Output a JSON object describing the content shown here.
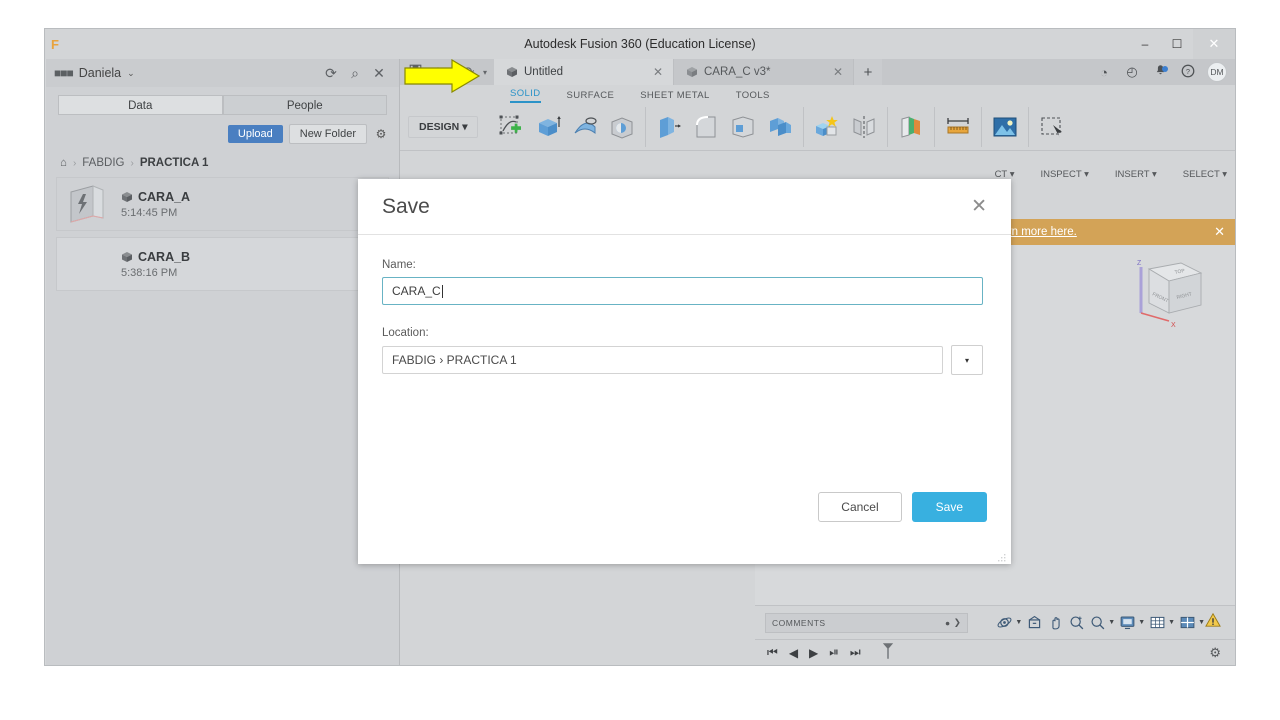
{
  "window": {
    "title": "Autodesk Fusion 360 (Education License)",
    "logo": "F",
    "minimize": "–",
    "maximize": "☐",
    "close": "✕"
  },
  "data_panel": {
    "user_name": "Daniela",
    "user_caret": "⌄",
    "people_icon": "people-icon",
    "refresh_icon": "⟳",
    "search_icon": "⌕",
    "close_icon": "✕",
    "tabs": [
      {
        "label": "Data",
        "active": true
      },
      {
        "label": "People",
        "active": false
      }
    ],
    "upload_label": "Upload",
    "new_folder_label": "New Folder",
    "gear_icon": "⚙",
    "breadcrumb": {
      "home_icon": "⌂",
      "items": [
        "FABDIG",
        "PRACTICA 1"
      ],
      "separator": "›"
    },
    "files": [
      {
        "name": "CARA_A",
        "time": "5:14:45 PM",
        "selected": true
      },
      {
        "name": "CARA_B",
        "time": "5:38:16 PM",
        "selected": false
      }
    ]
  },
  "quick_access": {
    "save_icon": "save-icon",
    "undo_icon": "↶",
    "redo_icon": "↷",
    "dropdown_caret": "▾"
  },
  "doc_tabs": [
    {
      "label": "Untitled",
      "active": true,
      "close": "✕"
    },
    {
      "label": "CARA_C v3*",
      "active": false,
      "close": "✕"
    }
  ],
  "tab_plus": "+",
  "top_right_icons": [
    {
      "name": "job-status-icon",
      "glyph": "◔"
    },
    {
      "name": "recent-activity-icon",
      "glyph": "◴"
    },
    {
      "name": "notifications-bell-icon",
      "glyph": "🔔"
    },
    {
      "name": "help-icon",
      "glyph": "?"
    }
  ],
  "avatar_initials": "DM",
  "ribbon": {
    "tabs": [
      {
        "label": "SOLID",
        "active": true
      },
      {
        "label": "SURFACE",
        "active": false
      },
      {
        "label": "SHEET METAL",
        "active": false
      },
      {
        "label": "TOOLS",
        "active": false
      }
    ],
    "design_label": "DESIGN",
    "design_caret": "▾",
    "group_labels": [
      "CT ▾",
      "INSPECT ▾",
      "INSERT ▾",
      "SELECT ▾"
    ],
    "tools": [
      "create-sketch-icon",
      "extrude-icon",
      "revolve-icon",
      "hole-icon",
      "shell-icon",
      "fillet-icon",
      "draft-icon",
      "combine-icon",
      "appearance-icon",
      "mirror-icon",
      "plane-icon",
      "measure-icon",
      "insert-image-icon",
      "select-icon"
    ]
  },
  "banner": {
    "text": "earn more here.",
    "close": "✕"
  },
  "viewcube": {
    "axis_z": "Z",
    "axis_x": "X",
    "face_top": "TOP",
    "face_front": "FRONT",
    "face_right": "RIGHT"
  },
  "bottom": {
    "comments_label": "COMMENTS",
    "comments_badge": "●",
    "comments_expand": "❯",
    "nav_tools": [
      {
        "name": "orbit-icon",
        "caret": "▾"
      },
      {
        "name": "look-at-icon",
        "caret": ""
      },
      {
        "name": "pan-icon",
        "caret": ""
      },
      {
        "name": "zoom-window-icon",
        "caret": ""
      },
      {
        "name": "zoom-icon",
        "caret": "▾"
      },
      {
        "name": "display-settings-icon",
        "caret": "▾"
      },
      {
        "name": "grid-snaps-icon",
        "caret": "▾"
      },
      {
        "name": "viewports-icon",
        "caret": "▾"
      }
    ],
    "warning_icon": "⚠",
    "playback": [
      "⏮",
      "◀",
      "▶",
      "⏭",
      "⏯"
    ],
    "settings_icon": "⚙"
  },
  "dialog": {
    "title": "Save",
    "close_icon": "✕",
    "name_label": "Name:",
    "name_value": "CARA_C",
    "location_label": "Location:",
    "location_value": "FABDIG › PRACTICA 1",
    "location_dropdown_caret": "▾",
    "cancel_label": "Cancel",
    "save_label": "Save"
  },
  "annotation": {
    "arrow_color": "#ffff00",
    "arrow_target": "save-icon"
  },
  "colors": {
    "accent_blue": "#38b0e0",
    "ribbon_active": "#2b93c8",
    "upload_blue": "#4a7fc1",
    "banner_orange": "#d3a357",
    "window_bg": "#d3d5d7"
  }
}
